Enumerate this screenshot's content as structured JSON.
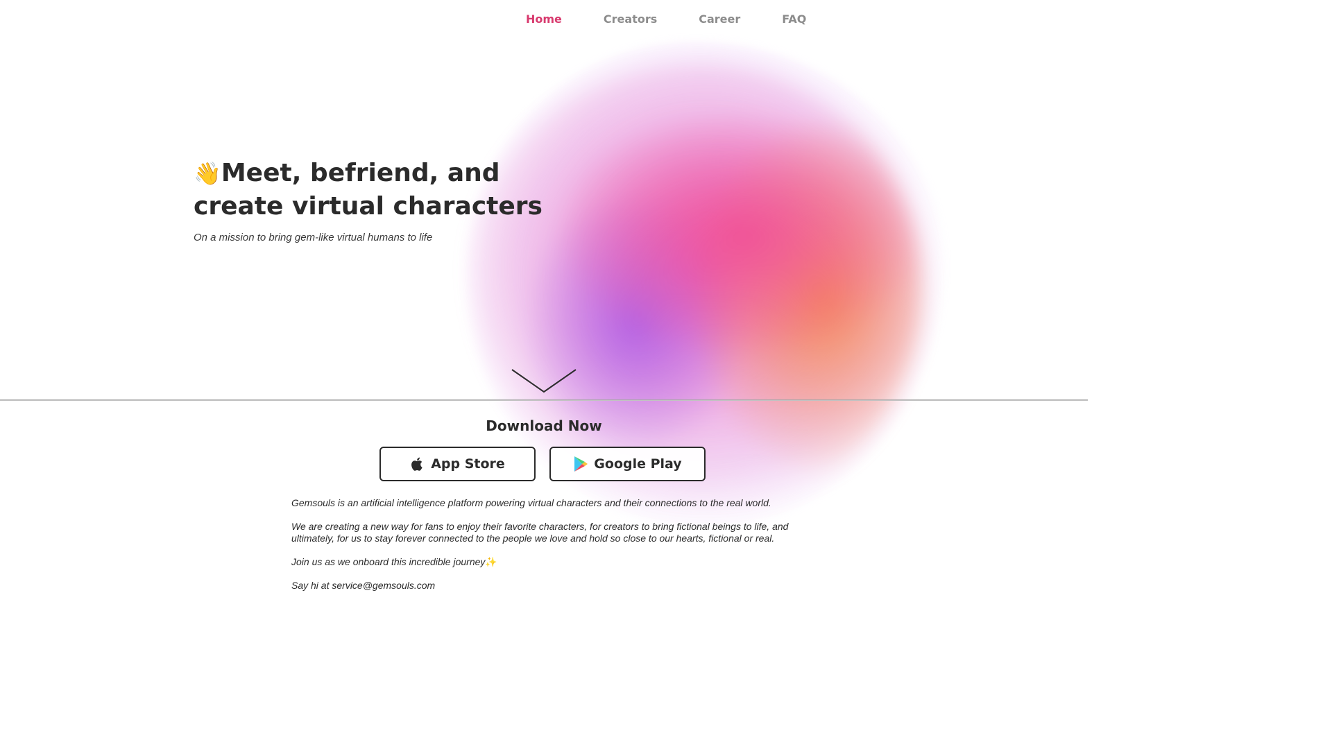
{
  "nav": {
    "items": [
      {
        "label": "Home",
        "active": true
      },
      {
        "label": "Creators",
        "active": false
      },
      {
        "label": "Career",
        "active": false
      },
      {
        "label": "FAQ",
        "active": false
      }
    ]
  },
  "hero": {
    "wave_emoji": "👋",
    "title_line1": "Meet, befriend, and",
    "title_line2": "create virtual characters",
    "subtitle": "On a mission to bring gem-like virtual humans to life"
  },
  "download": {
    "title": "Download Now",
    "app_store_label": "App Store",
    "google_play_label": "Google Play",
    "app_store_icon": "apple-icon",
    "google_play_icon": "google-play-icon"
  },
  "about": {
    "para1": "Gemsouls is an artificial intelligence platform powering virtual characters and their connections to the real world.",
    "para2": "We are creating a new way for fans to enjoy their favorite characters, for creators to bring fictional beings to life, and ultimately, for us to stay forever connected to the people we love and hold so close to our hearts, fictional or real.",
    "para3": "Join us as we onboard this incredible journey",
    "sparkle": "✨",
    "para4": "Say hi at service@gemsouls.com"
  },
  "colors": {
    "accent": "#d83a6e",
    "nav_inactive": "#8c8c8c",
    "text": "#2b2b2b"
  }
}
